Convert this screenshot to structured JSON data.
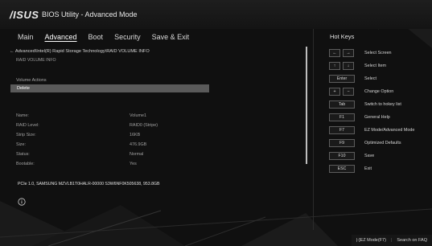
{
  "app": {
    "logo": "/ISUS",
    "title": "BIOS Utility - Advanced Mode"
  },
  "tabs": [
    "Main",
    "Advanced",
    "Boot",
    "Security",
    "Save & Exit"
  ],
  "breadcrumb": "←  Advanced\\Intel(R) Rapid Storage Technology\\RAID VOLUME INFO",
  "subheading": "RAID VOLUME INFO",
  "section_label": "Volume Actions",
  "delete_label": "Delete",
  "info_rows": [
    {
      "key": "Name:",
      "value": "Volume1"
    },
    {
      "key": "RAID Level:",
      "value": "RAID0 (Stripe)"
    },
    {
      "key": "Strip Size:",
      "value": "16KB"
    },
    {
      "key": "Size:",
      "value": "476.9GB"
    },
    {
      "key": "Status:",
      "value": "Normal"
    },
    {
      "key": "Bootable:",
      "value": "Yes"
    }
  ],
  "device": "PCIe 1.0, SAMSUNG MZVLB1T0HALR-00000 S3W6NF0K505638, 953.8GB",
  "hotkeys_title": "Hot Keys",
  "hotkeys": [
    {
      "keys": [
        "←",
        "→"
      ],
      "desc": "Select Screen"
    },
    {
      "keys": [
        "↑",
        "↓"
      ],
      "desc": "Select Item"
    },
    {
      "keys": [
        "Enter"
      ],
      "desc": "Select"
    },
    {
      "keys": [
        "+",
        "−"
      ],
      "desc": "Change Option"
    },
    {
      "keys": [
        "Tab"
      ],
      "desc": "Switch to hokey list"
    },
    {
      "keys": [
        "F1"
      ],
      "desc": "General Help"
    },
    {
      "keys": [
        "F7"
      ],
      "desc": "EZ Mode/Advanced Mode"
    },
    {
      "keys": [
        "F9"
      ],
      "desc": "Optimized Defaults"
    },
    {
      "keys": [
        "F10"
      ],
      "desc": "Save"
    },
    {
      "keys": [
        "ESC"
      ],
      "desc": "Exit"
    }
  ],
  "footer": {
    "ez_mode": "|-]EZ Mode(F7)",
    "search": "Search on FAQ"
  }
}
